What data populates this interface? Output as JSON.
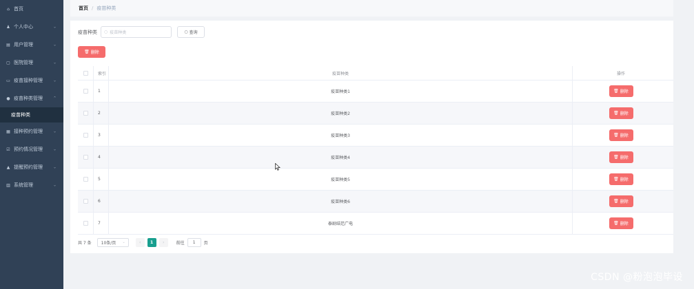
{
  "sidebar": {
    "items": [
      {
        "icon": "home-icon",
        "glyph": "⌂",
        "label": "首页",
        "chevron": ""
      },
      {
        "icon": "user-icon",
        "glyph": "♟",
        "label": "个人中心",
        "chevron": "⌄"
      },
      {
        "icon": "users-icon",
        "glyph": "▤",
        "label": "用户管理",
        "chevron": "⌄"
      },
      {
        "icon": "hospital-icon",
        "glyph": "▢",
        "label": "医院管理",
        "chevron": "⌄"
      },
      {
        "icon": "syringe-icon",
        "glyph": "▭",
        "label": "疫苗接种管理",
        "chevron": "⌄"
      },
      {
        "icon": "location-icon",
        "glyph": "●",
        "label": "疫苗种类管理",
        "chevron": "⌃"
      }
    ],
    "active_sub": "疫苗种类",
    "items_after": [
      {
        "icon": "calendar-icon",
        "glyph": "▦",
        "label": "接种预约管理",
        "chevron": "⌄"
      },
      {
        "icon": "report-icon",
        "glyph": "☑",
        "label": "预约情况管理",
        "chevron": "⌄"
      },
      {
        "icon": "bell-icon",
        "glyph": "▲",
        "label": "提醒预约管理",
        "chevron": "⌄"
      },
      {
        "icon": "system-icon",
        "glyph": "▥",
        "label": "系统管理",
        "chevron": "⌄"
      }
    ]
  },
  "breadcrumb": {
    "home": "首页",
    "separator": "/",
    "current": "疫苗种类"
  },
  "search": {
    "label": "疫苗种类",
    "placeholder": "疫苗种类",
    "query_label": "查询"
  },
  "toolbar": {
    "delete_label": "删除"
  },
  "table": {
    "headers": {
      "index": "索引",
      "name": "疫苗种类",
      "operation": "操作"
    },
    "rows": [
      {
        "index": "1",
        "name": "疫苗种类1",
        "op": "删除"
      },
      {
        "index": "2",
        "name": "疫苗种类2",
        "op": "删除"
      },
      {
        "index": "3",
        "name": "疫苗种类3",
        "op": "删除"
      },
      {
        "index": "4",
        "name": "疫苗种类4",
        "op": "删除"
      },
      {
        "index": "5",
        "name": "疫苗种类5",
        "op": "删除"
      },
      {
        "index": "6",
        "name": "疫苗种类6",
        "op": "删除"
      },
      {
        "index": "7",
        "name": "泰剧结范广电",
        "op": "删除"
      }
    ]
  },
  "pagination": {
    "total": "共 7 条",
    "page_size": "10条/页",
    "prev": "‹",
    "current_page": "1",
    "next": "›",
    "goto": "前往",
    "jump_value": "1",
    "unit": "页"
  },
  "watermark": "CSDN @粉泡泡毕设",
  "colors": {
    "sidebar_bg": "#304156",
    "danger": "#f56c6c",
    "active_page": "#189f8f"
  }
}
